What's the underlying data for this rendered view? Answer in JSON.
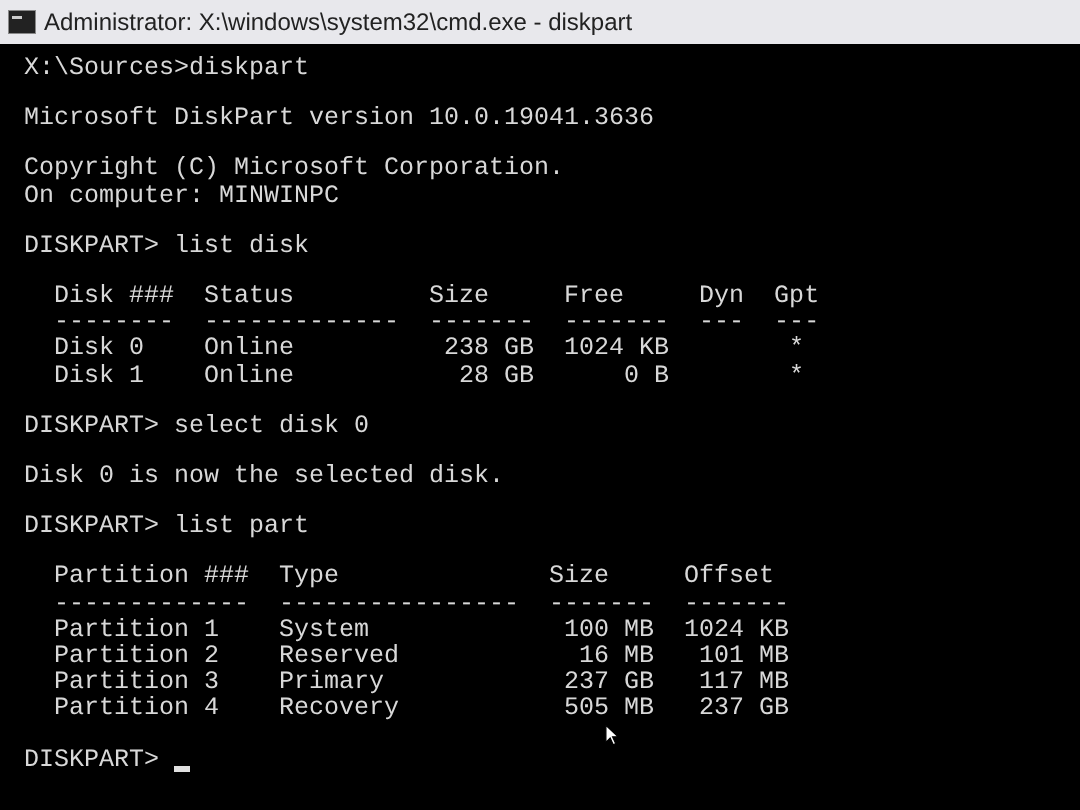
{
  "window": {
    "title": "Administrator: X:\\windows\\system32\\cmd.exe - diskpart"
  },
  "console": {
    "blocks": [
      [
        "X:\\Sources>diskpart"
      ],
      [
        "Microsoft DiskPart version 10.0.19041.3636"
      ],
      [
        "Copyright (C) Microsoft Corporation.",
        "On computer: MINWINPC"
      ],
      [
        "DISKPART> list disk"
      ],
      [
        "  Disk ###  Status         Size     Free     Dyn  Gpt",
        "  --------  -------------  -------  -------  ---  ---",
        "  Disk 0    Online          238 GB  1024 KB        *",
        "  Disk 1    Online           28 GB      0 B        *"
      ],
      [
        "DISKPART> select disk 0"
      ],
      [
        "Disk 0 is now the selected disk."
      ],
      [
        "DISKPART> list part"
      ],
      [
        "  Partition ###  Type              Size     Offset",
        "  -------------  ----------------  -------  -------",
        "  Partition 1    System             100 MB  1024 KB",
        "  Partition 2    Reserved            16 MB   101 MB",
        "  Partition 3    Primary            237 GB   117 MB",
        "  Partition 4    Recovery           505 MB   237 GB"
      ]
    ],
    "prompt": "DISKPART> "
  }
}
